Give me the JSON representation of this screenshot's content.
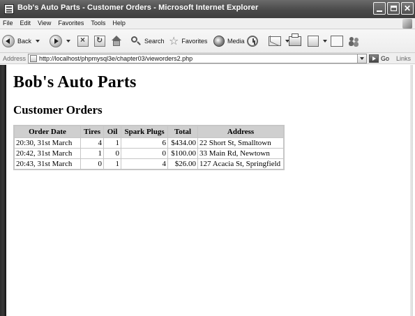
{
  "window": {
    "title": "Bob's Auto Parts - Customer Orders - Microsoft Internet Explorer"
  },
  "menu": {
    "items": [
      "File",
      "Edit",
      "View",
      "Favorites",
      "Tools",
      "Help"
    ]
  },
  "toolbar": {
    "back_label": "Back",
    "search_label": "Search",
    "favorites_label": "Favorites",
    "media_label": "Media"
  },
  "address_bar": {
    "label": "Address",
    "url": "http://localhost/phpmysql3e/chapter03/vieworders2.php",
    "go_label": "Go",
    "links_label": "Links"
  },
  "page": {
    "heading": "Bob's Auto Parts",
    "subheading": "Customer Orders",
    "table": {
      "headers": [
        "Order Date",
        "Tires",
        "Oil",
        "Spark Plugs",
        "Total",
        "Address"
      ],
      "rows": [
        [
          "20:30, 31st March",
          "4",
          "1",
          "6",
          "$434.00",
          "22 Short St, Smalltown"
        ],
        [
          "20:42, 31st March",
          "1",
          "0",
          "0",
          "$100.00",
          "33 Main Rd, Newtown"
        ],
        [
          "20:43, 31st March",
          "0",
          "1",
          "4",
          "$26.00",
          "127 Acacia St, Springfield"
        ]
      ]
    }
  }
}
